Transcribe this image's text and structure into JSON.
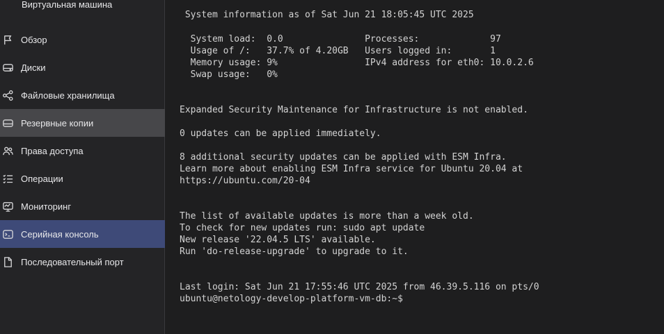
{
  "sidebar": {
    "title": "Виртуальная машина",
    "items": [
      {
        "label": "Обзор",
        "icon": "flag-icon"
      },
      {
        "label": "Диски",
        "icon": "disk-icon"
      },
      {
        "label": "Файловые хранилища",
        "icon": "share-icon"
      },
      {
        "label": "Резервные копии",
        "icon": "backup-icon"
      },
      {
        "label": "Права доступа",
        "icon": "users-icon"
      },
      {
        "label": "Операции",
        "icon": "list-icon"
      },
      {
        "label": "Мониторинг",
        "icon": "monitor-icon"
      },
      {
        "label": "Серийная консоль",
        "icon": "console-icon"
      },
      {
        "label": "Последовательный порт",
        "icon": "file-icon"
      }
    ],
    "hover_index": 3,
    "active_index": 7
  },
  "colors": {
    "sidebar_bg": "#242426",
    "hover_bg": "#47474a",
    "active_bg": "#3e4a78",
    "terminal_bg": "#1e1e1f",
    "terminal_text": "#d3d3d3"
  },
  "terminal": {
    "lines": [
      " System information as of Sat Jun 21 18:05:45 UTC 2025",
      "",
      "  System load:  0.0               Processes:             97",
      "  Usage of /:   37.7% of 4.20GB   Users logged in:       1",
      "  Memory usage: 9%                IPv4 address for eth0: 10.0.2.6",
      "  Swap usage:   0%",
      "",
      "",
      "Expanded Security Maintenance for Infrastructure is not enabled.",
      "",
      "0 updates can be applied immediately.",
      "",
      "8 additional security updates can be applied with ESM Infra.",
      "Learn more about enabling ESM Infra service for Ubuntu 20.04 at",
      "https://ubuntu.com/20-04",
      "",
      "",
      "",
      "The list of available updates is more than a week old.",
      "To check for new updates run: sudo apt update",
      "New release '22.04.5 LTS' available.",
      "Run 'do-release-upgrade' to upgrade to it.",
      "",
      "",
      "Last login: Sat Jun 21 17:55:46 UTC 2025 from 46.39.5.116 on pts/0",
      "ubuntu@netology-develop-platform-vm-db:~$"
    ]
  }
}
